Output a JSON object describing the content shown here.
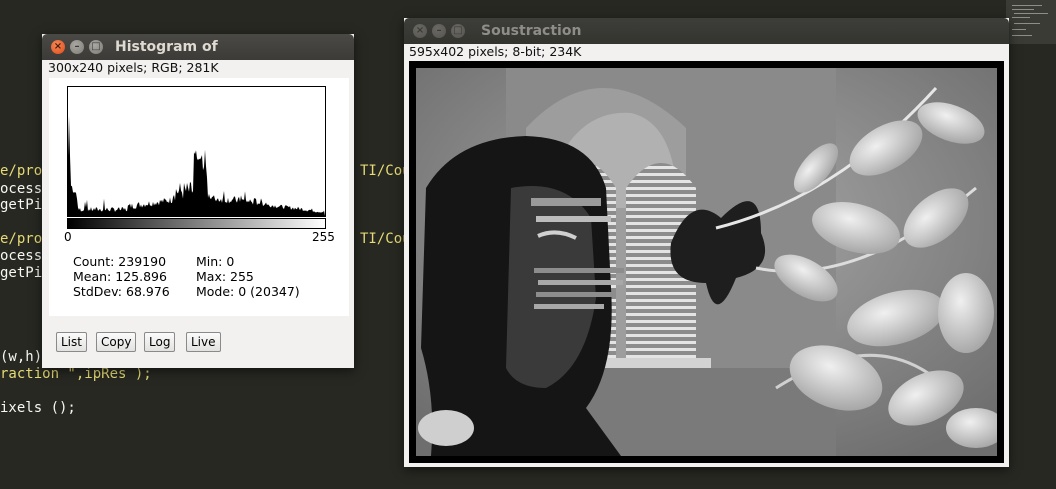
{
  "editor": {
    "lines": [
      {
        "text": "e/prot",
        "color": "yellow"
      },
      {
        "text": "ocesso",
        "color": "white"
      },
      {
        "text": "getPix",
        "color": "white"
      },
      {
        "text": "e/prot",
        "color": "yellow"
      },
      {
        "text": "ocesso",
        "color": "white"
      },
      {
        "text": "getPix",
        "color": "white"
      },
      {
        "text": "(w,h)",
        "color": "white"
      },
      {
        "text": "raction \",ipRes );",
        "color": "yellow"
      },
      {
        "text": "ixels ();",
        "color": "white"
      }
    ],
    "right_fragments": [
      "TI/Cou",
      "TI/Cou"
    ]
  },
  "histogram_window": {
    "title": "Histogram of",
    "info": "300x240 pixels; RGB; 281K",
    "close_glyph": "×",
    "minimize_glyph": "–",
    "maximize_glyph": "□",
    "x_min_label": "0",
    "x_max_label": "255",
    "stats": {
      "count": "Count: 239190",
      "mean": "Mean: 125.896",
      "stddev": "StdDev: 68.976",
      "min": "Min: 0",
      "max": "Max: 255",
      "mode": "Mode: 0 (20347)"
    },
    "buttons": {
      "list": "List",
      "copy": "Copy",
      "log": "Log",
      "live": "Live"
    }
  },
  "image_window": {
    "title": "Soustraction",
    "info": "595x402 pixels; 8-bit; 234K",
    "close_glyph": "×",
    "minimize_glyph": "–",
    "maximize_glyph": "□"
  },
  "colors": {
    "editor_bg": "#272822",
    "titlebar": "#3c3b37",
    "close_button": "#df4a16",
    "window_bg": "#f2f1f0"
  }
}
